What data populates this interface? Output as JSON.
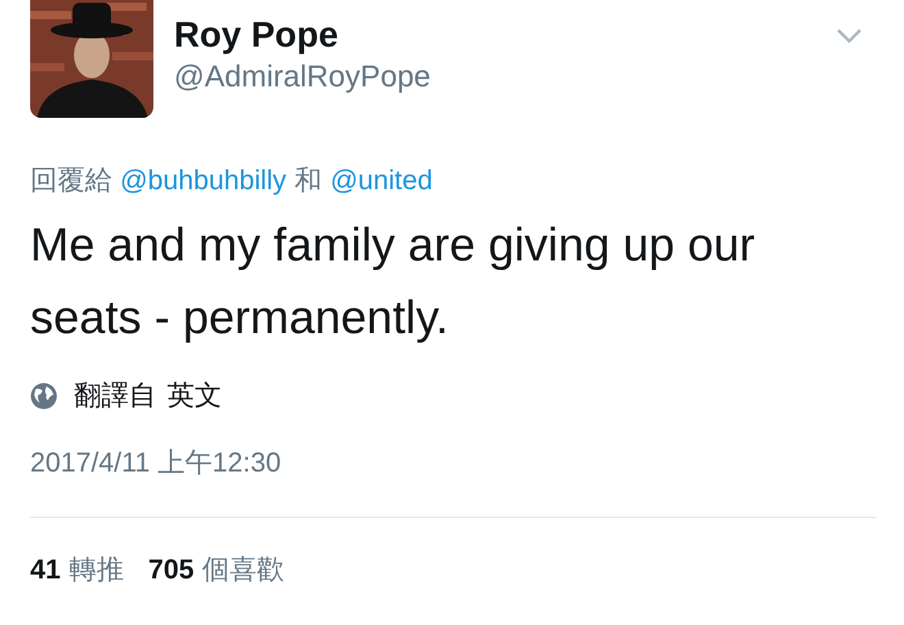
{
  "user": {
    "name": "Roy Pope",
    "handle": "@AdmiralRoyPope"
  },
  "reply_to": {
    "prefix": "回覆給",
    "mentions": [
      "@buhbuhbilly",
      "@united"
    ],
    "joiner": "和"
  },
  "text": "Me and my family are giving up our seats - permanently.",
  "translation": {
    "label": "翻譯自",
    "language": "英文"
  },
  "timestamp": "2017/4/11 上午12:30",
  "stats": [
    {
      "count": "41",
      "label": "轉推"
    },
    {
      "count": "705",
      "label": "個喜歡"
    }
  ]
}
